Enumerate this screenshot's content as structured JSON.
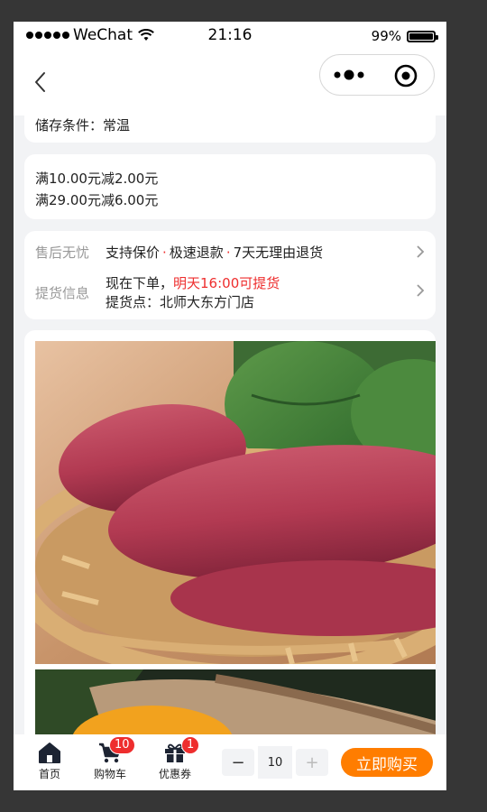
{
  "status_bar": {
    "carrier": "WeChat",
    "time": "21:16",
    "battery": "99%"
  },
  "info": {
    "storage": "储存条件：常温"
  },
  "promotions": [
    "满10.00元减2.00元",
    "满29.00元减6.00元"
  ],
  "service": {
    "after_sale_label": "售后无忧",
    "after_sale_items": [
      "支持保价",
      "极速退款",
      "7天无理由退货"
    ],
    "pickup_label": "提货信息",
    "pickup_prefix": "现在下单，",
    "pickup_time": "明天16:00可提货",
    "pickup_point": "提货点：北师大东方门店"
  },
  "bottom_bar": {
    "home_label": "首页",
    "cart_label": "购物车",
    "cart_badge": "10",
    "coupon_label": "优惠券",
    "coupon_badge": "1",
    "quantity": "10",
    "buy_label": "立即购买"
  },
  "colors": {
    "accent_red": "#ee2e2e",
    "buy_orange": "#ff7d00",
    "bg_gray": "#f2f3f5"
  }
}
